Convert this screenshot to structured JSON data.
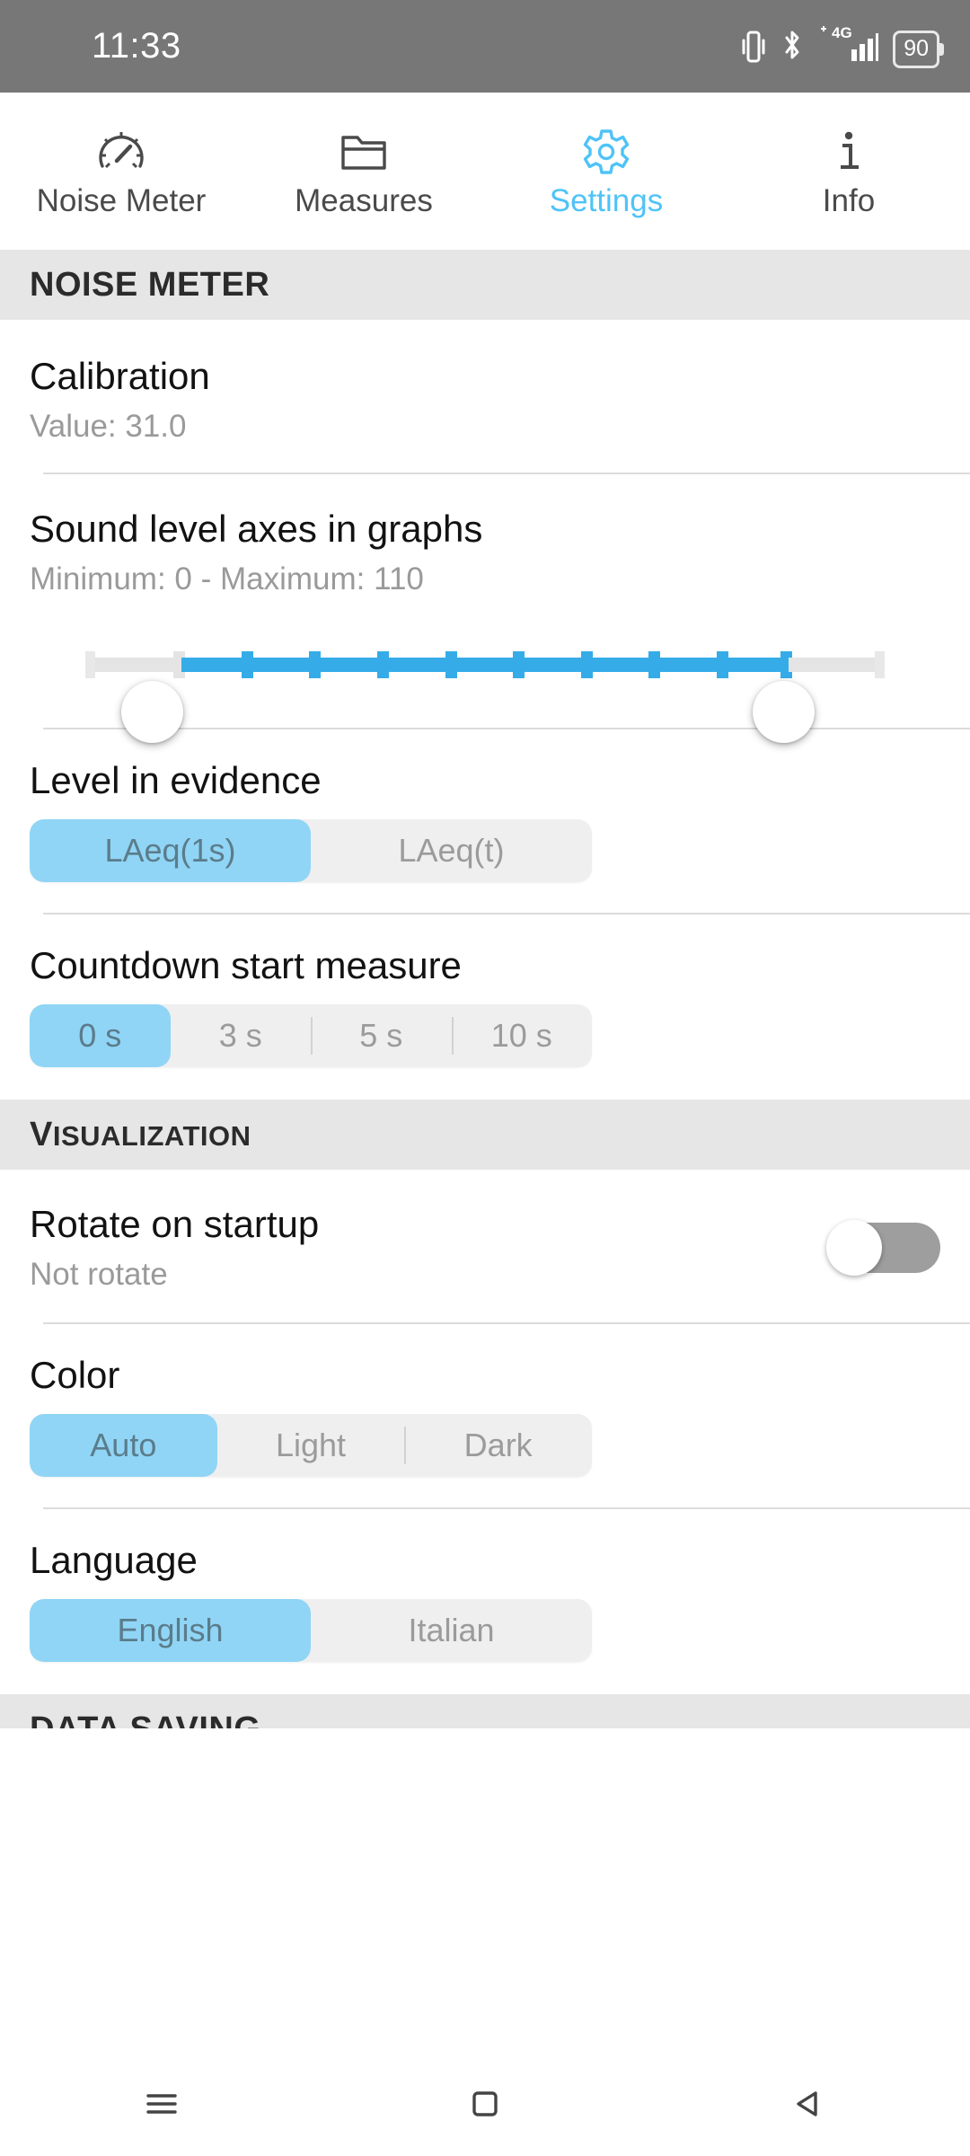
{
  "status_bar": {
    "time": "11:33",
    "battery_level": "90",
    "icons": [
      "vibrate-icon",
      "bluetooth-icon",
      "network-4g-icon",
      "signal-icon",
      "battery-icon"
    ],
    "network_label": "4G",
    "background_color": "#777777"
  },
  "tabs": [
    {
      "label": "Noise Meter",
      "icon": "gauge-icon",
      "active": false
    },
    {
      "label": "Measures",
      "icon": "folder-icon",
      "active": false
    },
    {
      "label": "Settings",
      "icon": "gear-icon",
      "active": true
    },
    {
      "label": "Info",
      "icon": "info-icon",
      "active": false
    }
  ],
  "accent_color": "#4fc3f7",
  "sections": {
    "noise_meter": {
      "header": "NOISE METER",
      "calibration": {
        "title": "Calibration",
        "value_text": "Value: 31.0"
      },
      "sound_level_axes": {
        "title": "Sound level axes in graphs",
        "value_text": "Minimum: 0 - Maximum: 110",
        "minimum": 0,
        "maximum": 110,
        "range_start_percent": 11,
        "range_end_percent": 87
      },
      "level_in_evidence": {
        "title": "Level in evidence",
        "options": [
          "LAeq(1s)",
          "LAeq(t)"
        ],
        "selected": "LAeq(1s)"
      },
      "countdown": {
        "title": "Countdown start measure",
        "options": [
          "0 s",
          "3 s",
          "5 s",
          "10 s"
        ],
        "selected": "0 s"
      }
    },
    "visualization": {
      "header_first": "V",
      "header_rest": "ISUALIZATION",
      "rotate_on_startup": {
        "title": "Rotate on startup",
        "value_text": "Not rotate",
        "enabled": false
      },
      "color": {
        "title": "Color",
        "options": [
          "Auto",
          "Light",
          "Dark"
        ],
        "selected": "Auto"
      },
      "language": {
        "title": "Language",
        "options": [
          "English",
          "Italian"
        ],
        "selected": "English"
      }
    },
    "data_saving": {
      "header": "DATA SAVING"
    }
  },
  "nav_bar": {
    "buttons": [
      "recents-icon",
      "home-icon",
      "back-icon"
    ]
  }
}
